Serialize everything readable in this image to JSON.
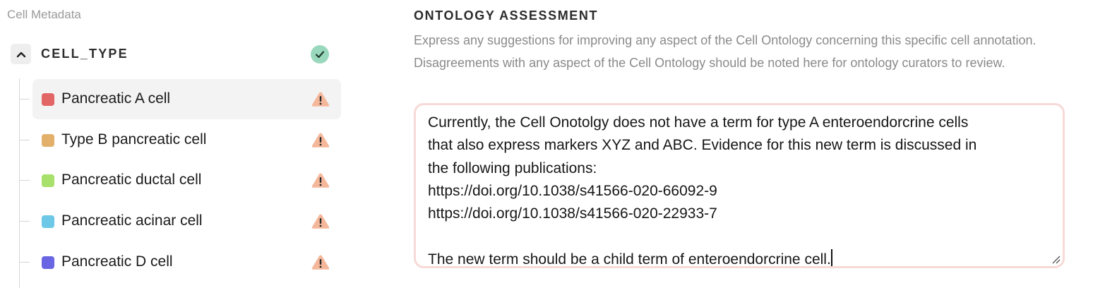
{
  "sidebar": {
    "section_title": "Cell Metadata",
    "group": {
      "title": "CELL_TYPE",
      "collapse_icon": "chevron-up-icon",
      "status_icon": "check-circle-icon",
      "status_color": "#9ad8bd"
    },
    "items": [
      {
        "label": "Pancreatic A cell",
        "color": "#e36666",
        "selected": true,
        "status_icon": "warning-icon"
      },
      {
        "label": "Type B pancreatic cell",
        "color": "#e3b06c",
        "selected": false,
        "status_icon": "warning-icon"
      },
      {
        "label": "Pancreatic ductal cell",
        "color": "#a8e06c",
        "selected": false,
        "status_icon": "warning-icon"
      },
      {
        "label": "Pancreatic acinar cell",
        "color": "#6cc8e6",
        "selected": false,
        "status_icon": "warning-icon"
      },
      {
        "label": "Pancreatic D cell",
        "color": "#6a66e3",
        "selected": false,
        "status_icon": "warning-icon"
      }
    ],
    "warning_color": "#f5b79a"
  },
  "assessment": {
    "title": "ONTOLOGY ASSESSMENT",
    "description": "Express any suggestions for improving any aspect of the Cell Ontology concerning this specific cell annotation. Disagreements with any aspect of the Cell Ontology should be noted here for ontology curators to review.",
    "text_lines": [
      "Currently, the Cell Onotolgy does not have a term for type A enteroendorcrine cells",
      "that also express markers XYZ and ABC. Evidence for this new term is discussed in",
      "the following publications:",
      "https://doi.org/10.1038/s41566-020-66092-9",
      "https://doi.org/10.1038/s41566-020-22933-7",
      ""
    ],
    "last_line_prefix": "The new term should be a child term of ",
    "last_line_misspelled": "enteroendorcrine",
    "last_line_suffix": " cell.",
    "border_color": "#f7dad7"
  }
}
